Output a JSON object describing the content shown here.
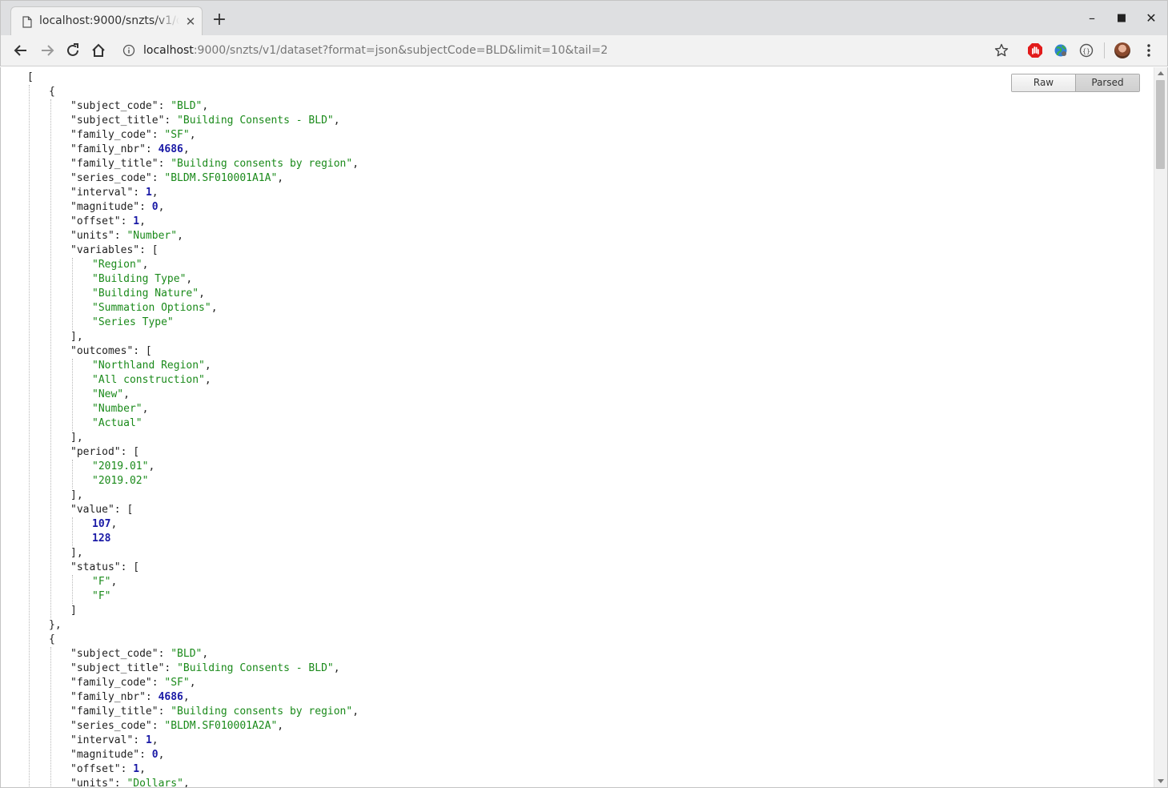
{
  "browser": {
    "tab_title": "localhost:9000/snzts/v1/dataset?format=json&subjectCode=BLD&limit=10&tail=2",
    "new_tab_label": "+",
    "url_host": "localhost",
    "url_rest": ":9000/snzts/v1/dataset?format=json&subjectCode=BLD&limit=10&tail=2",
    "icons": [
      "back-arrow-icon",
      "forward-arrow-icon",
      "reload-icon",
      "home-icon",
      "info-icon",
      "star-icon",
      "opera-adblock-icon",
      "globe-extension-icon",
      "json-formatter-icon",
      "profile-avatar",
      "kebab-menu-icon"
    ]
  },
  "viewer": {
    "raw_label": "Raw",
    "parsed_label": "Parsed",
    "active_view": "Parsed"
  },
  "colors": {
    "string": "#1a8a1a",
    "number": "#1a1aa6",
    "key": "#222222"
  },
  "records": [
    {
      "subject_code": "BLD",
      "subject_title": "Building Consents - BLD",
      "family_code": "SF",
      "family_nbr": 4686,
      "family_title": "Building consents by region",
      "series_code": "BLDM.SF010001A1A",
      "interval": 1,
      "magnitude": 0,
      "offset": 1,
      "units": "Number",
      "variables": [
        "Region",
        "Building Type",
        "Building Nature",
        "Summation Options",
        "Series Type"
      ],
      "outcomes": [
        "Northland Region",
        "All construction",
        "New",
        "Number",
        "Actual"
      ],
      "period": [
        "2019.01",
        "2019.02"
      ],
      "value": [
        107,
        128
      ],
      "status": [
        "F",
        "F"
      ]
    },
    {
      "subject_code": "BLD",
      "subject_title": "Building Consents - BLD",
      "family_code": "SF",
      "family_nbr": 4686,
      "family_title": "Building consents by region",
      "series_code": "BLDM.SF010001A2A",
      "interval": 1,
      "magnitude": 0,
      "offset": 1,
      "units": "Dollars"
    }
  ]
}
